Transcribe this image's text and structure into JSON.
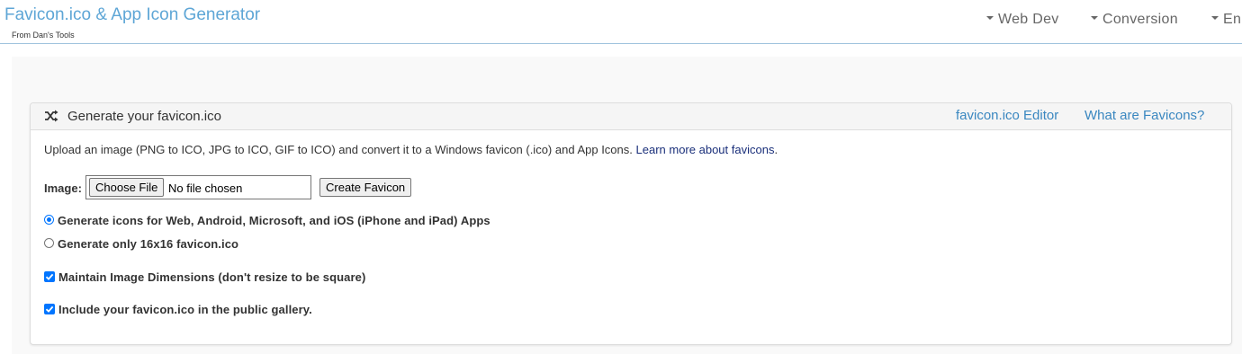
{
  "header": {
    "title": "Favicon.ico & App Icon Generator",
    "subtitle": "From Dan's Tools",
    "nav": [
      "Web Dev",
      "Conversion",
      "En"
    ]
  },
  "panel": {
    "title": "Generate your favicon.ico",
    "links": [
      "favicon.ico Editor",
      "What are Favicons?"
    ],
    "description": "Upload an image (PNG to ICO, JPG to ICO, GIF to ICO) and convert it to a Windows favicon (.ico) and App Icons.",
    "learn_more": "Learn more about favicons",
    "period": ".",
    "image_label": "Image:",
    "choose_file": "Choose File",
    "file_status": "No file chosen",
    "create_button": "Create Favicon",
    "options": {
      "radio_all": {
        "label": "Generate icons for Web, Android, Microsoft, and iOS (iPhone and iPad) Apps",
        "checked": true
      },
      "radio_16": {
        "label": "Generate only 16x16 favicon.ico",
        "checked": false
      },
      "maintain": {
        "label": "Maintain Image Dimensions (don't resize to be square)",
        "checked": true
      },
      "gallery": {
        "label": "Include your favicon.ico in the public gallery.",
        "checked": true
      }
    }
  },
  "colors": {
    "brand": "#5ea6d6",
    "link": "#3a87c0",
    "accent": "#0075ff"
  }
}
